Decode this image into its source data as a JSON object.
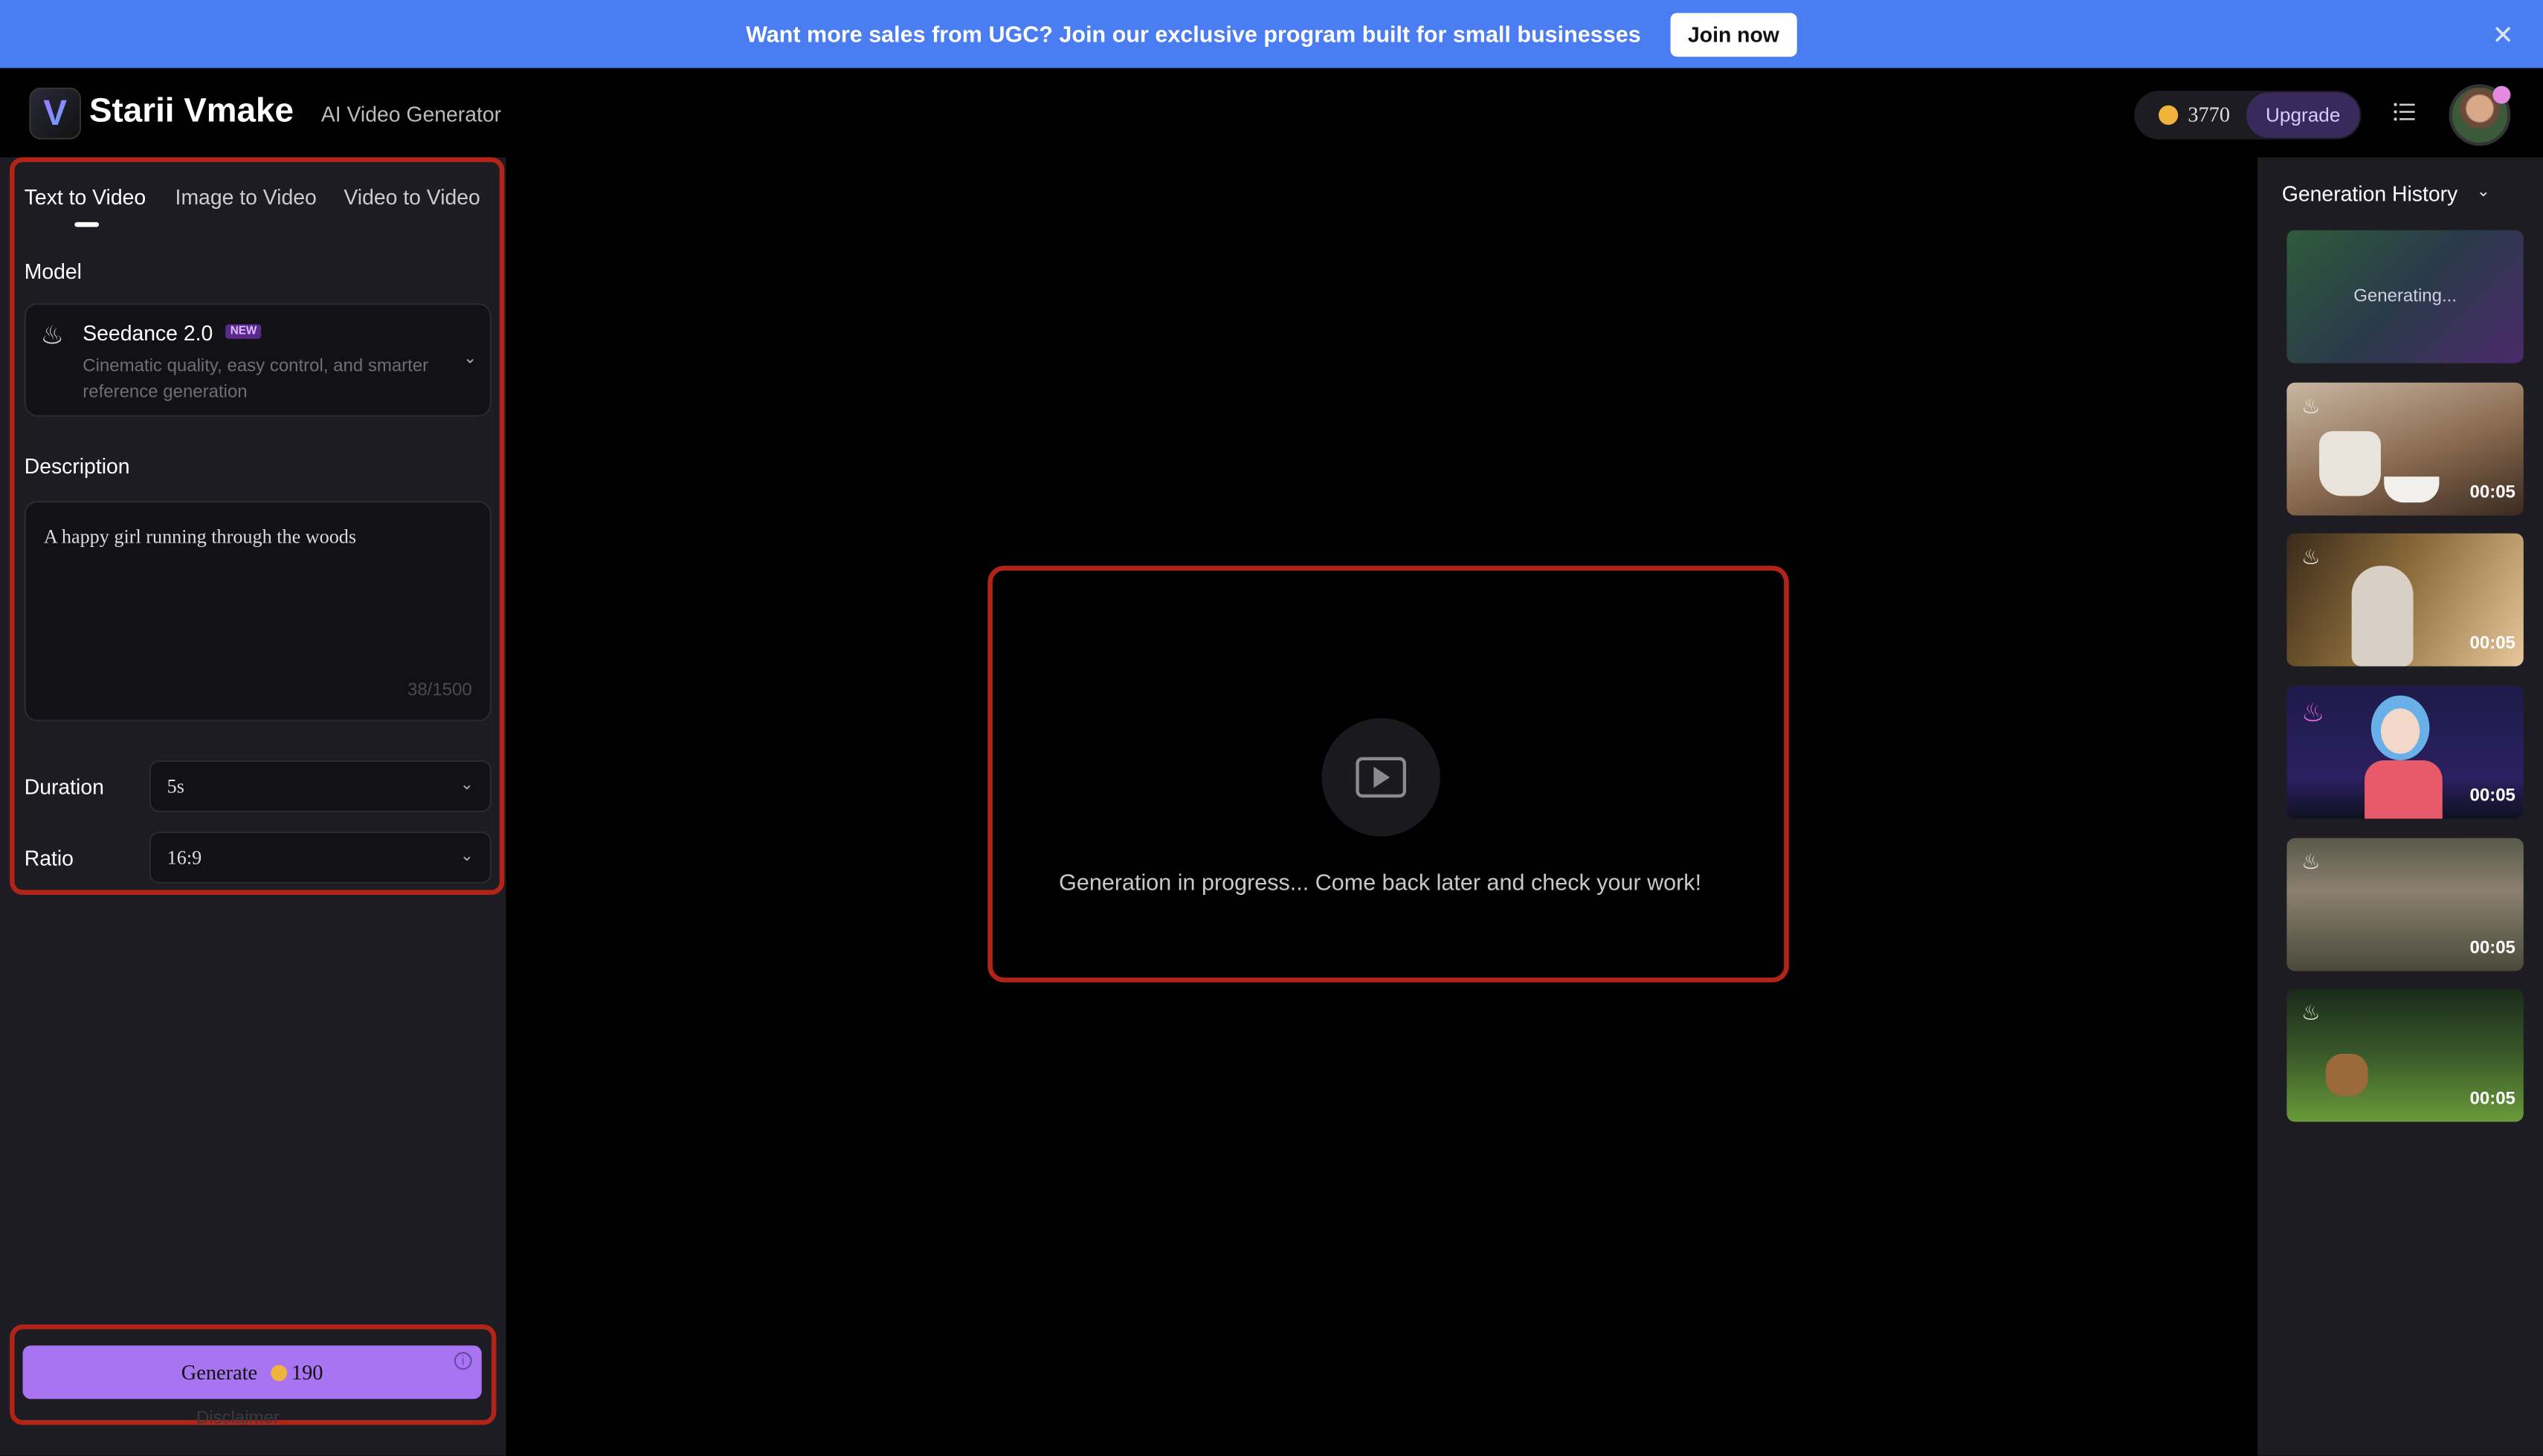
{
  "banner": {
    "message": "Want more sales from UGC? Join our exclusive program built for small businesses",
    "cta": "Join now",
    "close_glyph": "✕"
  },
  "header": {
    "logo_letter": "V",
    "brand": "Starii Vmake",
    "subtitle": "AI Video Generator",
    "credits": "3770",
    "upgrade": "Upgrade"
  },
  "tabs": [
    "Text to Video",
    "Image to Video",
    "Video to Video"
  ],
  "model": {
    "label": "Model",
    "name": "Seedance 2.0",
    "badge": "NEW",
    "description": "Cinematic quality, easy control, and smarter reference generation"
  },
  "description": {
    "label": "Description",
    "value": "A happy girl running through the woods",
    "count": "38/1500"
  },
  "duration": {
    "label": "Duration",
    "value": "5s"
  },
  "ratio": {
    "label": "Ratio",
    "value": "16:9"
  },
  "generate": {
    "label": "Generate",
    "cost": "190"
  },
  "disclaimer": "Disclaimer",
  "preview": {
    "message": "Generation in progress... Come back later and check your work!"
  },
  "history": {
    "title": "Generation History",
    "generating": "Generating...",
    "items": [
      {
        "duration": "00:05",
        "scene": "kettle-pouring"
      },
      {
        "duration": "00:05",
        "scene": "elderly-woman-drinking"
      },
      {
        "duration": "00:05",
        "scene": "cartoon-girl-phone"
      },
      {
        "duration": "00:05",
        "scene": "grass-field"
      },
      {
        "duration": "00:05",
        "scene": "cat-on-lawn"
      }
    ]
  },
  "colors": {
    "banner": "#4a7cf2",
    "accent": "#a874f2",
    "highlight_border": "#b32418",
    "panel": "#1c1c22"
  }
}
